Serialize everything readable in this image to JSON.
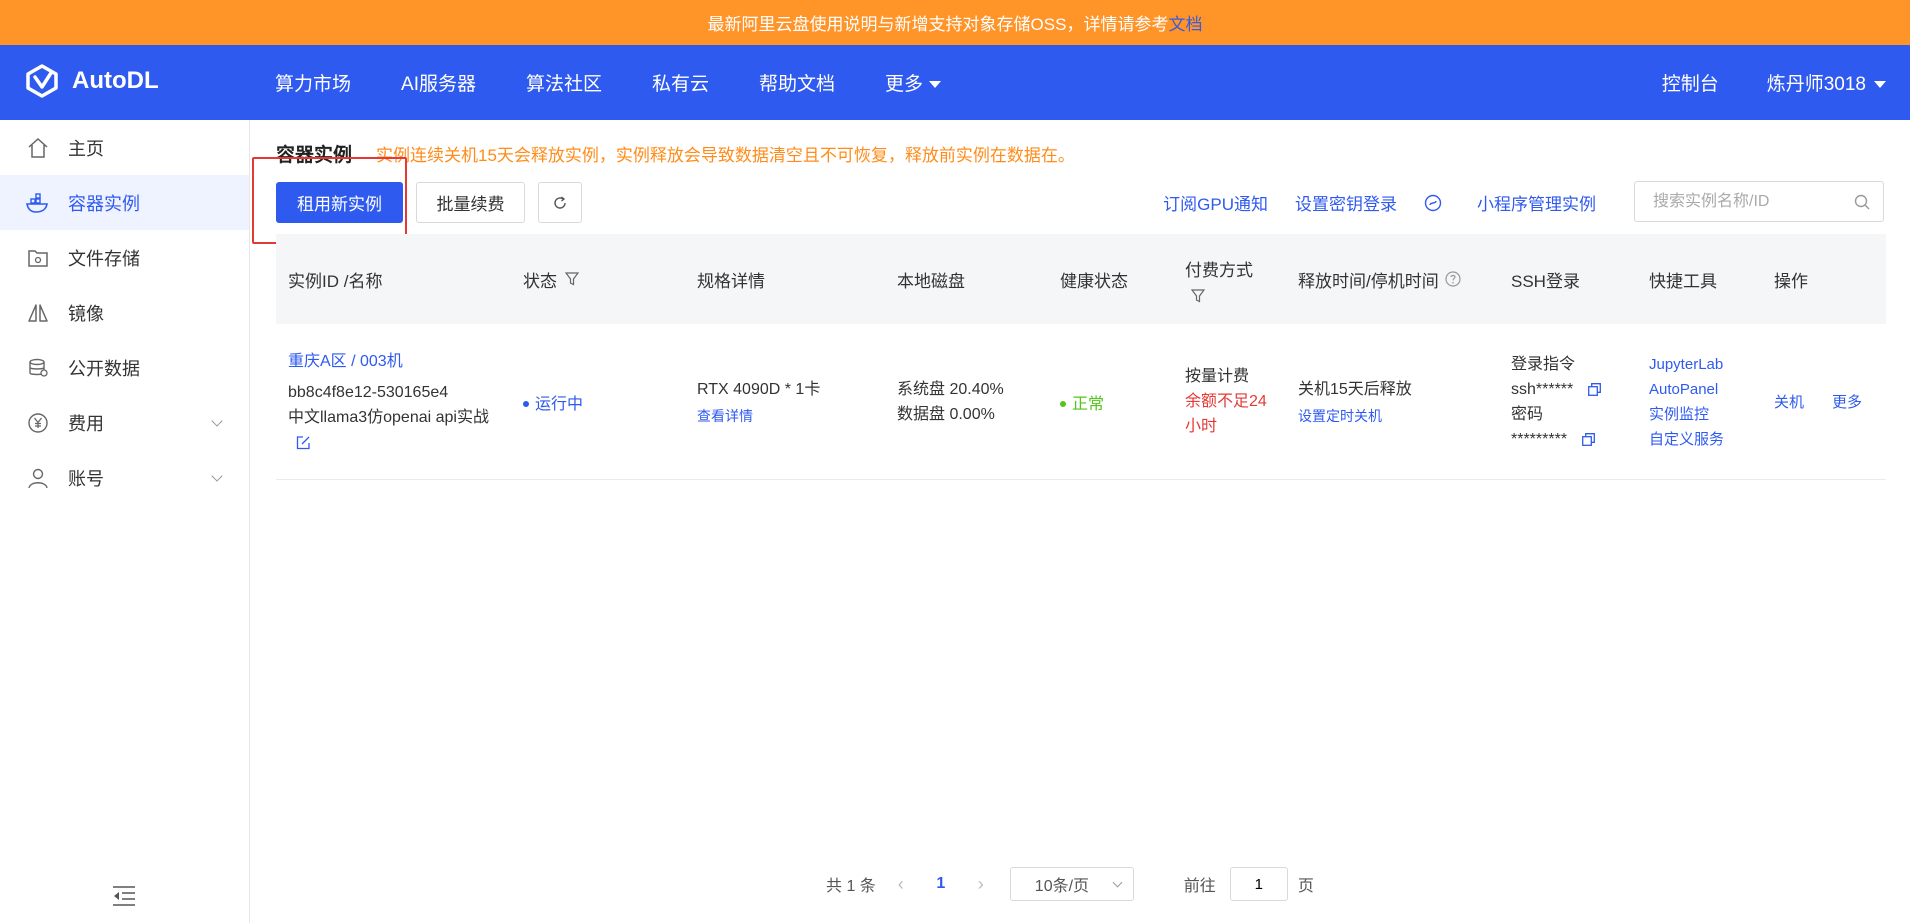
{
  "notice": {
    "text": "最新阿里云盘使用说明与新增支持对象存储OSS，详情请参考",
    "link": "文档"
  },
  "brand": {
    "name": "AutoDL"
  },
  "nav": {
    "items": [
      "算力市场",
      "AI服务器",
      "算法社区",
      "私有云",
      "帮助文档",
      "更多"
    ],
    "console": "控制台",
    "user": "炼丹师3018"
  },
  "sidebar": {
    "items": [
      {
        "label": "主页",
        "icon": "home-icon"
      },
      {
        "label": "容器实例",
        "icon": "container-icon"
      },
      {
        "label": "文件存储",
        "icon": "storage-icon"
      },
      {
        "label": "镜像",
        "icon": "mirror-icon"
      },
      {
        "label": "公开数据",
        "icon": "database-icon"
      },
      {
        "label": "费用",
        "icon": "yen-icon"
      },
      {
        "label": "账号",
        "icon": "user-icon"
      }
    ]
  },
  "main": {
    "title": "容器实例",
    "warning": "实例连续关机15天会释放实例，实例释放会导致数据清空且不可恢复，释放前实例在数据在。",
    "rent_button": "租用新实例",
    "renew_button": "批量续费",
    "links": {
      "subscribe_gpu": "订阅GPU通知",
      "ssh_key": "设置密钥登录",
      "miniprogram": "小程序管理实例"
    },
    "search_placeholder": "搜索实例名称/ID"
  },
  "table": {
    "headers": {
      "id_name": "实例ID /名称",
      "status": "状态",
      "spec": "规格详情",
      "disk": "本地磁盘",
      "health": "健康状态",
      "billing": "付费方式",
      "release": "释放时间/停机时间",
      "ssh": "SSH登录",
      "tools": "快捷工具",
      "actions": "操作"
    },
    "row": {
      "region": "重庆A区 / 003机",
      "instance_id": "bb8c4f8e12-530165e4",
      "name": "中文llama3仿openai api实战",
      "status": "运行中",
      "gpu": "RTX 4090D * 1卡",
      "spec_detail": "查看详情",
      "sys_disk": "系统盘 20.40%",
      "data_disk": "数据盘 0.00%",
      "health": "正常",
      "billing_type": "按量计费",
      "billing_warning": "余额不足24小时",
      "release_text": "关机15天后释放",
      "schedule_shutdown": "设置定时关机",
      "ssh_cmd_label": "登录指令",
      "ssh_cmd": "ssh******",
      "ssh_pwd_label": "密码",
      "ssh_pwd": "*********",
      "tools": [
        "JupyterLab",
        "AutoPanel",
        "实例监控",
        "自定义服务"
      ],
      "action_shutdown": "关机",
      "action_more": "更多"
    }
  },
  "pager": {
    "total": "共 1 条",
    "current": "1",
    "page_size": "10条/页",
    "goto_label": "前往",
    "goto_value": "1",
    "page_suffix": "页"
  },
  "colors": {
    "primary": "#2f5af0",
    "notice": "#ff9429",
    "warning": "#ff8c1a",
    "danger": "#e53935",
    "success": "#52c41a"
  }
}
